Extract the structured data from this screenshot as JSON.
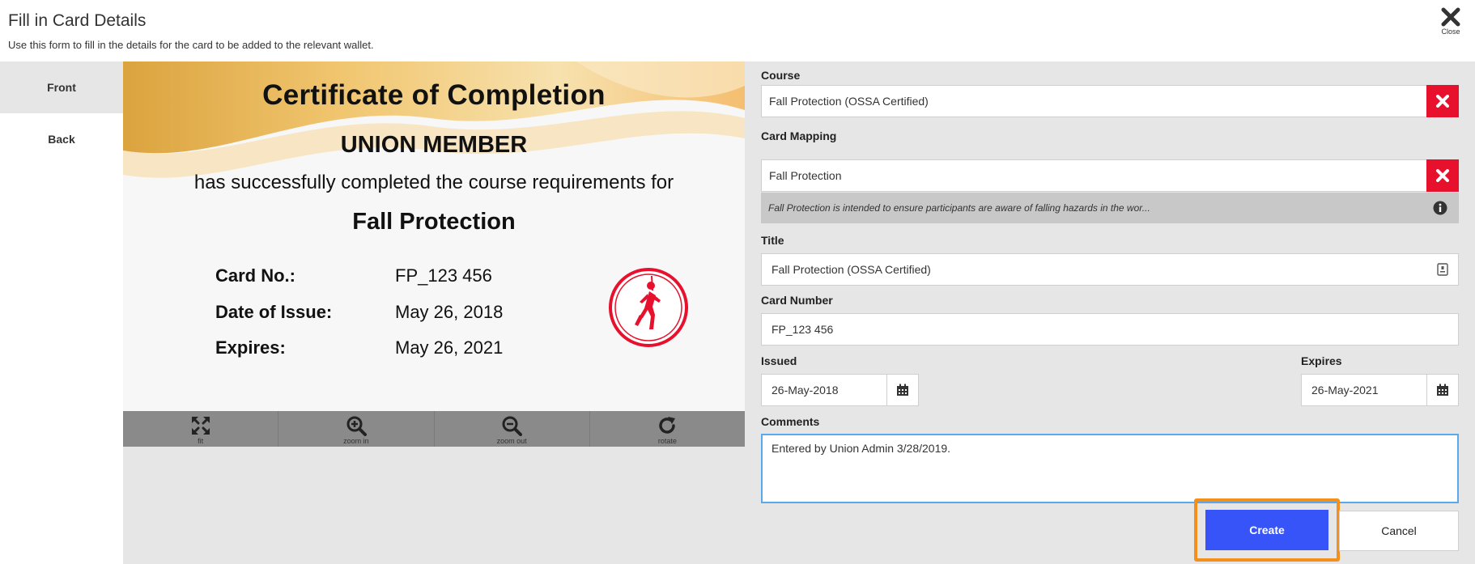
{
  "header": {
    "title": "Fill in Card Details",
    "subtitle": "Use this form to fill in the details for the card to be added to the relevant wallet.",
    "close_label": "Close"
  },
  "side_tabs": [
    {
      "label": "Front",
      "active": true
    },
    {
      "label": "Back",
      "active": false
    }
  ],
  "certificate": {
    "heading": "Certificate of Completion",
    "recipient": "UNION MEMBER",
    "statement": "has successfully completed the course requirements for",
    "course": "Fall Protection",
    "card_no_label": "Card No.:",
    "card_no_value": "FP_123 456",
    "issue_label": "Date of Issue:",
    "issue_value": "May 26, 2018",
    "expires_label": "Expires:",
    "expires_value": "May 26, 2021"
  },
  "viewer_tools": [
    {
      "label": "fit",
      "icon": "fit-expand-icon"
    },
    {
      "label": "zoom in",
      "icon": "zoom-in-icon"
    },
    {
      "label": "zoom out",
      "icon": "zoom-out-icon"
    },
    {
      "label": "rotate",
      "icon": "rotate-icon"
    }
  ],
  "form": {
    "course_label": "Course",
    "course_value": "Fall Protection (OSSA Certified)",
    "mapping_label": "Card Mapping",
    "mapping_value": "Fall Protection",
    "mapping_description": "Fall Protection is intended to ensure participants are aware of falling hazards in the wor...",
    "title_label": "Title",
    "title_value": "Fall Protection (OSSA Certified)",
    "card_number_label": "Card Number",
    "card_number_value": "FP_123 456",
    "issued_label": "Issued",
    "issued_value": "26-May-2018",
    "expires_label": "Expires",
    "expires_value": "26-May-2021",
    "comments_label": "Comments",
    "comments_value": "Entered by Union Admin 3/28/2019."
  },
  "actions": {
    "create_label": "Create",
    "cancel_label": "Cancel"
  },
  "colors": {
    "accent_blue": "#3754f8",
    "remove_red": "#e8112d",
    "highlight_orange": "#f3901d",
    "focus_blue": "#5aa9ea"
  }
}
